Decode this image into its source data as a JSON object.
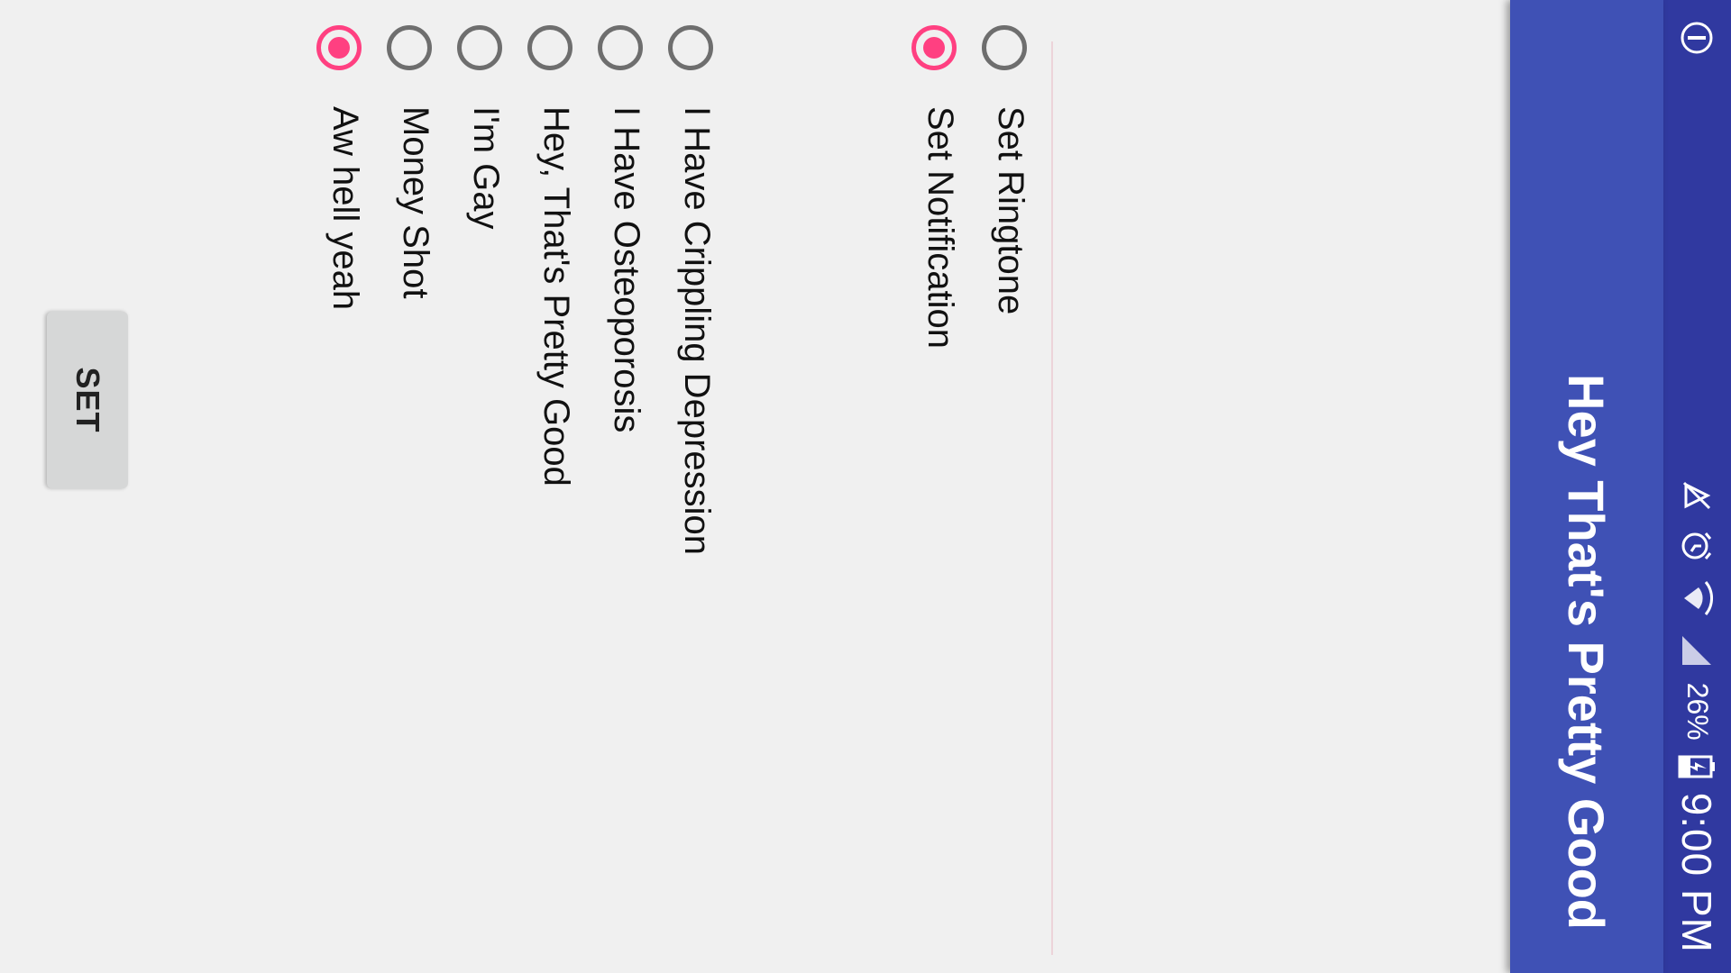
{
  "status_bar": {
    "time": "9:00 PM",
    "battery_percent": "26%",
    "icons": [
      "battery-charging-icon",
      "signal-icon",
      "wifi-data-icon",
      "alarm-icon",
      "notifications-muted-icon",
      "info-icon"
    ]
  },
  "app_bar": {
    "title": "Hey That's Pretty Good"
  },
  "type_options": {
    "items": [
      {
        "label": "Set Ringtone",
        "checked": false
      },
      {
        "label": "Set Notification",
        "checked": true
      }
    ]
  },
  "sound_options": {
    "items": [
      {
        "label": "I Have Crippling Depression",
        "checked": false
      },
      {
        "label": "I Have Osteoporosis",
        "checked": false
      },
      {
        "label": "Hey, That's Pretty Good",
        "checked": false
      },
      {
        "label": "I'm Gay",
        "checked": false
      },
      {
        "label": "Money Shot",
        "checked": false
      },
      {
        "label": "Aw hell yeah",
        "checked": true
      }
    ]
  },
  "set_button": {
    "label": "SET"
  },
  "colors": {
    "status_bar": "#3039a0",
    "app_bar": "#3f51b5",
    "accent": "#ff4081",
    "background": "#f0f0f0"
  }
}
